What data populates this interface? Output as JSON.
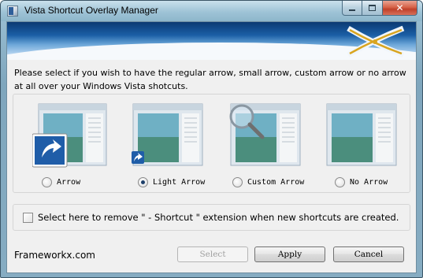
{
  "window": {
    "title": "Vista Shortcut Overlay Manager"
  },
  "prompt": "Please select if you wish to have the regular arrow, small arrow, custom arrow or no arrow at all over your Windows Vista shotcuts.",
  "options": [
    {
      "label": "Arrow",
      "selected": false,
      "overlay": "large-arrow"
    },
    {
      "label": "Light Arrow",
      "selected": true,
      "overlay": "small-arrow"
    },
    {
      "label": "Custom Arrow",
      "selected": false,
      "overlay": "magnifier"
    },
    {
      "label": "No Arrow",
      "selected": false,
      "overlay": "none"
    }
  ],
  "remove_extension": {
    "label": "Select here to remove \" - Shortcut \" extension when new shortcuts are created.",
    "checked": false
  },
  "footer": {
    "brand": "Frameworkx.com",
    "select_label": "Select",
    "apply_label": "Apply",
    "cancel_label": "Cancel"
  },
  "colors": {
    "accent": "#1b5fa6",
    "logo_gold": "#d9a520"
  }
}
